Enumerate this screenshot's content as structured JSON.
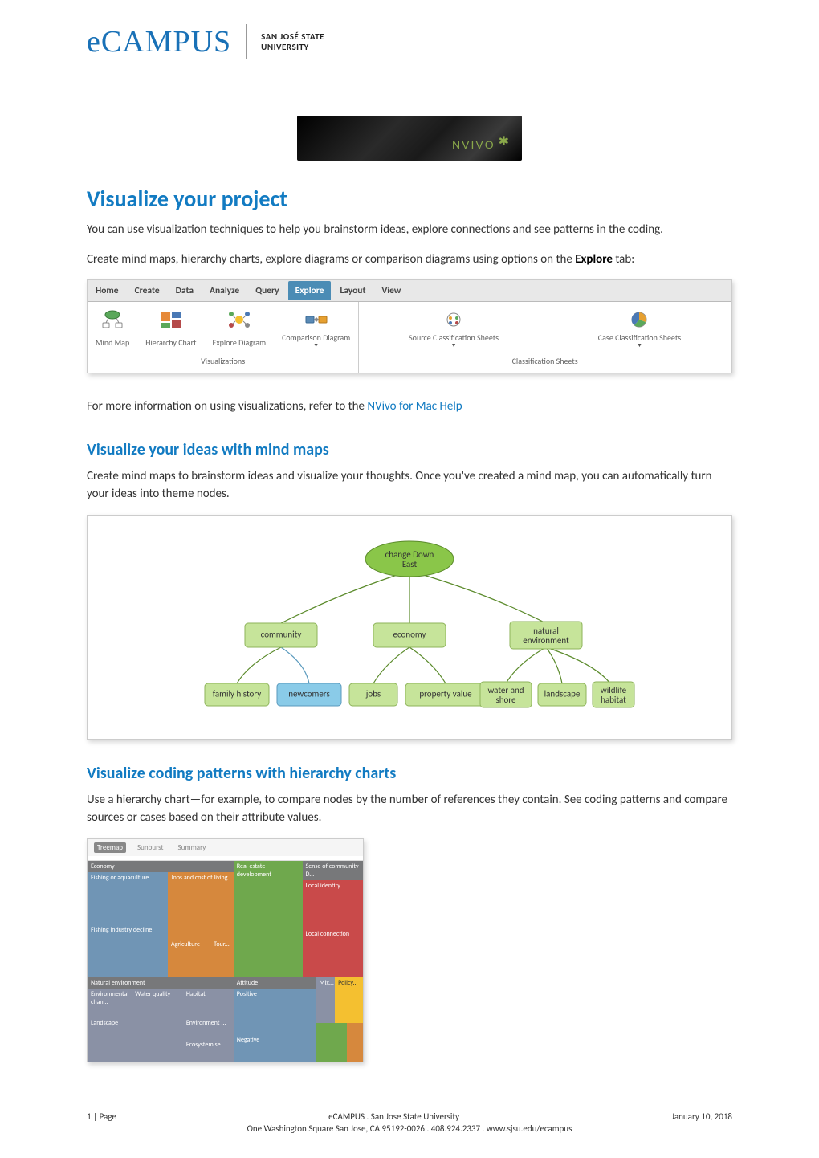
{
  "header": {
    "logo_text": "eCAMPUS",
    "university_line1": "SAN JOSÉ STATE",
    "university_line2": "UNIVERSITY"
  },
  "banner": {
    "text": "NVIVO"
  },
  "h1": "Visualize your project",
  "p1": "You can use visualization techniques to help you brainstorm ideas, explore connections and see patterns in the coding.",
  "p2a": "Create mind maps, hierarchy charts, explore diagrams or comparison diagrams using options on the ",
  "p2b": "Explore",
  "p2c": " tab:",
  "ribbon": {
    "tabs": [
      "Home",
      "Create",
      "Data",
      "Analyze",
      "Query",
      "Explore",
      "Layout",
      "View"
    ],
    "active_tab": "Explore",
    "groups": [
      {
        "label": "Visualizations",
        "items": [
          {
            "label": "Mind Map"
          },
          {
            "label": "Hierarchy Chart"
          },
          {
            "label": "Explore Diagram"
          },
          {
            "label": "Comparison Diagram",
            "dropdown": true
          }
        ]
      },
      {
        "label": "Classification Sheets",
        "items": [
          {
            "label": "Source Classification Sheets",
            "dropdown": true
          },
          {
            "label": "Case Classification Sheets",
            "dropdown": true
          }
        ]
      }
    ]
  },
  "p3a": "For more information on using visualizations, refer to the ",
  "p3b": "NVivo for Mac Help",
  "h2a": "Visualize your ideas with mind maps",
  "p4": "Create mind maps to brainstorm ideas and visualize your thoughts. Once you've created a mind map, you can automatically turn your ideas into theme nodes.",
  "mindmap": {
    "root": "change Down East",
    "level1": [
      "community",
      "economy",
      "natural environment"
    ],
    "children": {
      "community": [
        "family history",
        "newcomers"
      ],
      "economy": [
        "jobs",
        "property value"
      ],
      "natural environment": [
        "water and shore",
        "landscape",
        "wildlife habitat"
      ]
    },
    "selected": "newcomers"
  },
  "h2b": "Visualize coding patterns with hierarchy charts",
  "p5": "Use a hierarchy chart—for example, to compare nodes by the number of references they contain. See coding patterns and compare sources or cases based on their attribute values.",
  "treemap": {
    "tabs": [
      "Treemap",
      "Sunburst",
      "Summary"
    ],
    "active": "Treemap",
    "groups": {
      "economy": {
        "label": "Economy",
        "items": [
          "Fishing or aquaculture",
          "Fishing industry decline",
          "Jobs and cost of living",
          "Agriculture",
          "Tour..."
        ]
      },
      "natural": {
        "label": "Natural environment",
        "items": [
          "Environmental chan...",
          "Water quality",
          "Landscape",
          "Habitat",
          "Environment ...",
          "Ecosystem se..."
        ]
      },
      "real_estate": {
        "label": "Real estate development"
      },
      "sense": {
        "label": "Sense of community D...",
        "items": [
          "Local identity",
          "Local connection"
        ]
      },
      "attitude": {
        "label": "Attitude",
        "items": [
          "Positive",
          "Negative"
        ]
      },
      "mix": {
        "label": "Mix..."
      },
      "policy": {
        "label": "Policy..."
      }
    }
  },
  "footer": {
    "page": "1 | Page",
    "center": "eCAMPUS . San Jose State University",
    "date": "January 10, 2018",
    "address": "One Washington Square San Jose, CA 95192-0026 . 408.924.2337 . www.sjsu.edu/ecampus"
  }
}
